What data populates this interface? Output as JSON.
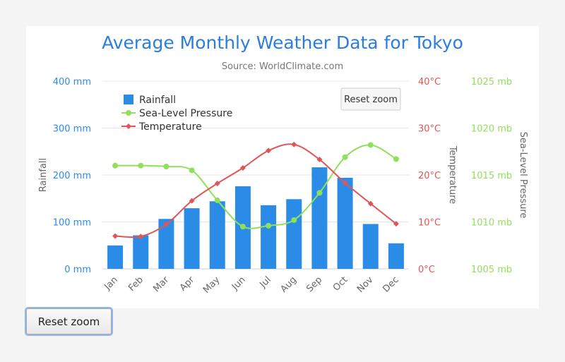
{
  "page": {
    "reset_button_label": "Reset zoom"
  },
  "chart_data": {
    "type": "bar",
    "title": "Average Monthly Weather Data for Tokyo",
    "subtitle": "Source: WorldClimate.com",
    "categories": [
      "Jan",
      "Feb",
      "Mar",
      "Apr",
      "May",
      "Jun",
      "Jul",
      "Aug",
      "Sep",
      "Oct",
      "Nov",
      "Dec"
    ],
    "series": [
      {
        "name": "Rainfall",
        "type": "bar",
        "axis": "rainfall",
        "color": "#2b8ce8",
        "values": [
          49.9,
          71.5,
          106.4,
          129.2,
          144.0,
          176.0,
          135.6,
          148.5,
          216.4,
          194.1,
          95.6,
          54.4
        ]
      },
      {
        "name": "Sea-Level Pressure",
        "type": "spline",
        "axis": "pressure",
        "color": "#90e05b",
        "marker": "circle",
        "values": [
          1016,
          1016,
          1015.9,
          1015.5,
          1012.3,
          1009.5,
          1009.6,
          1010.2,
          1013.1,
          1016.9,
          1018.2,
          1016.7
        ]
      },
      {
        "name": "Temperature",
        "type": "spline",
        "axis": "temperature",
        "color": "#e05656",
        "marker": "diamond",
        "values": [
          7.0,
          6.9,
          9.5,
          14.5,
          18.2,
          21.5,
          25.2,
          26.5,
          23.3,
          18.3,
          13.9,
          9.6
        ]
      }
    ],
    "axes": {
      "rainfall": {
        "title": "Rainfall",
        "tick_labels": [
          "0 mm",
          "100 mm",
          "200 mm",
          "300 mm",
          "400 mm"
        ],
        "ticks": [
          0,
          100,
          200,
          300,
          400
        ],
        "range": [
          0,
          400
        ],
        "color": "#2b8ce8",
        "side": "left"
      },
      "temperature": {
        "title": "Temperature",
        "tick_labels": [
          "0°C",
          "10°C",
          "20°C",
          "30°C",
          "40°C"
        ],
        "ticks": [
          0,
          10,
          20,
          30,
          40
        ],
        "range": [
          0,
          40
        ],
        "color": "#e05656",
        "side": "right"
      },
      "pressure": {
        "title": "Sea-Level Pressure",
        "tick_labels": [
          "1005 mb",
          "1010 mb",
          "1015 mb",
          "1020 mb",
          "1025 mb"
        ],
        "ticks": [
          1005,
          1010,
          1015,
          1020,
          1025
        ],
        "range": [
          1005,
          1025
        ],
        "color": "#90e05b",
        "side": "right"
      }
    },
    "legend": {
      "placement": "top-left inside plot",
      "items": [
        "Rainfall",
        "Sea-Level Pressure",
        "Temperature"
      ]
    },
    "reset_zoom_label": "Reset zoom",
    "grid": true
  }
}
